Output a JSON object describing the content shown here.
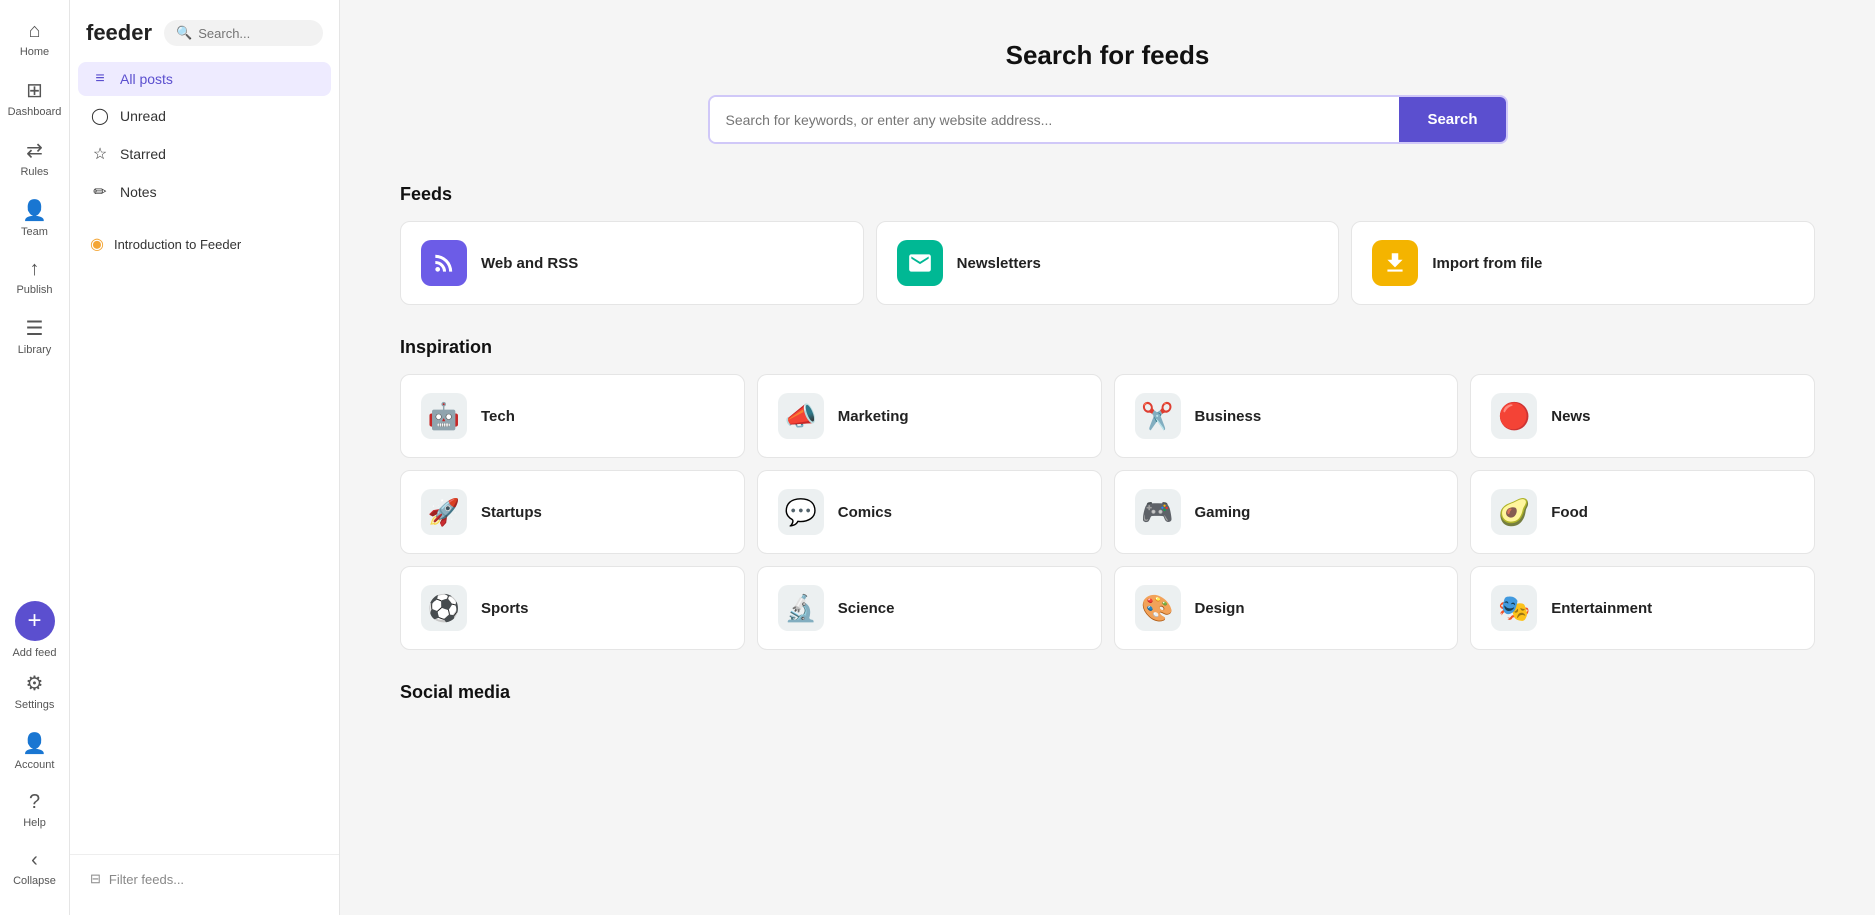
{
  "iconNav": {
    "items": [
      {
        "id": "home",
        "icon": "⊞",
        "label": "Home"
      },
      {
        "id": "dashboard",
        "icon": "▦",
        "label": "Dashboard"
      },
      {
        "id": "rules",
        "icon": "⇄",
        "label": "Rules"
      },
      {
        "id": "team",
        "icon": "👤",
        "label": "Team"
      },
      {
        "id": "publish",
        "icon": "↑",
        "label": "Publish"
      },
      {
        "id": "library",
        "icon": "☰",
        "label": "Library"
      }
    ],
    "bottom": [
      {
        "id": "add-feed",
        "label": "Add feed"
      },
      {
        "id": "settings",
        "icon": "⚙",
        "label": "Settings"
      },
      {
        "id": "account",
        "icon": "👤",
        "label": "Account"
      },
      {
        "id": "help",
        "icon": "?",
        "label": "Help"
      },
      {
        "id": "collapse",
        "icon": "‹",
        "label": "Collapse"
      }
    ]
  },
  "sidebar": {
    "logo": "feeder",
    "search": {
      "placeholder": "Search..."
    },
    "navItems": [
      {
        "id": "all-posts",
        "icon": "≡",
        "label": "All posts",
        "active": true
      },
      {
        "id": "unread",
        "icon": "◯",
        "label": "Unread",
        "active": false
      },
      {
        "id": "starred",
        "icon": "☆",
        "label": "Starred",
        "active": false
      },
      {
        "id": "notes",
        "icon": "✏",
        "label": "Notes",
        "active": false
      }
    ],
    "feeds": [
      {
        "id": "intro-feeder",
        "label": "Introduction to Feeder"
      }
    ],
    "filter": "Filter feeds..."
  },
  "main": {
    "title": "Search for feeds",
    "searchPlaceholder": "Search for keywords, or enter any website address...",
    "searchButton": "Search",
    "sections": {
      "feeds": {
        "title": "Feeds",
        "items": [
          {
            "id": "web-rss",
            "icon": "rss",
            "iconBg": "bg-purple",
            "label": "Web and RSS"
          },
          {
            "id": "newsletters",
            "icon": "mail",
            "iconBg": "bg-green",
            "label": "Newsletters"
          },
          {
            "id": "import-file",
            "icon": "download",
            "iconBg": "bg-yellow",
            "label": "Import from file"
          }
        ]
      },
      "inspiration": {
        "title": "Inspiration",
        "items": [
          {
            "id": "tech",
            "icon": "🤖",
            "label": "Tech"
          },
          {
            "id": "marketing",
            "icon": "📣",
            "label": "Marketing"
          },
          {
            "id": "business",
            "icon": "✂",
            "label": "Business"
          },
          {
            "id": "news",
            "icon": "🔴",
            "label": "News"
          },
          {
            "id": "startups",
            "icon": "🚀",
            "label": "Startups"
          },
          {
            "id": "comics",
            "icon": "💬",
            "label": "Comics"
          },
          {
            "id": "gaming",
            "icon": "🎮",
            "label": "Gaming"
          },
          {
            "id": "food",
            "icon": "🥑",
            "label": "Food"
          },
          {
            "id": "sports",
            "icon": "⚽",
            "label": "Sports"
          },
          {
            "id": "science",
            "icon": "🔬",
            "label": "Science"
          },
          {
            "id": "design",
            "icon": "🎨",
            "label": "Design"
          },
          {
            "id": "entertainment",
            "icon": "🎭",
            "label": "Entertainment"
          }
        ]
      },
      "socialMedia": {
        "title": "Social media"
      }
    }
  }
}
